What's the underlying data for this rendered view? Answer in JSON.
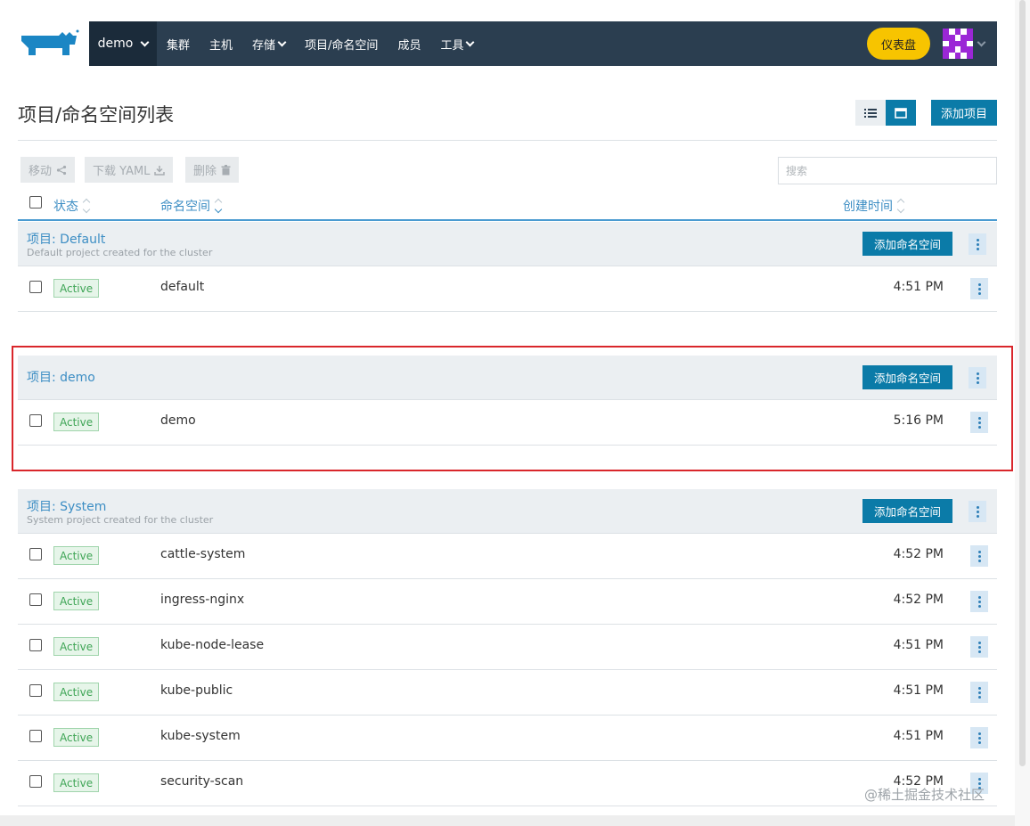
{
  "topbar": {
    "cluster": "demo",
    "nav": [
      "集群",
      "主机",
      "存储",
      "项目/命名空间",
      "成员",
      "工具"
    ],
    "dashboard_label": "仪表盘"
  },
  "header": {
    "title": "项目/命名空间列表",
    "add_project": "添加项目"
  },
  "toolbar": {
    "move": "移动",
    "download_yaml": "下载 YAML",
    "delete": "删除",
    "search_placeholder": "搜索"
  },
  "columns": {
    "state": "状态",
    "namespace": "命名空间",
    "created": "创建时间"
  },
  "add_namespace_label": "添加命名空间",
  "groups": [
    {
      "title": "项目: Default",
      "subtitle": "Default project created for the cluster",
      "rows": [
        {
          "state": "Active",
          "name": "default",
          "time": "4:51 PM"
        }
      ]
    },
    {
      "title": "项目: demo",
      "subtitle": "",
      "rows": [
        {
          "state": "Active",
          "name": "demo",
          "time": "5:16 PM"
        }
      ]
    },
    {
      "title": "项目: System",
      "subtitle": "System project created for the cluster",
      "rows": [
        {
          "state": "Active",
          "name": "cattle-system",
          "time": "4:52 PM"
        },
        {
          "state": "Active",
          "name": "ingress-nginx",
          "time": "4:52 PM"
        },
        {
          "state": "Active",
          "name": "kube-node-lease",
          "time": "4:51 PM"
        },
        {
          "state": "Active",
          "name": "kube-public",
          "time": "4:51 PM"
        },
        {
          "state": "Active",
          "name": "kube-system",
          "time": "4:51 PM"
        },
        {
          "state": "Active",
          "name": "security-scan",
          "time": "4:52 PM"
        }
      ]
    }
  ],
  "watermark": "@稀土掘金技术社区",
  "colors": {
    "nav_bg": "#2b3e50",
    "primary": "#0b7ba8",
    "dashboard": "#f7c400",
    "active_badge": "#3fa556",
    "highlight": "#d9262b"
  }
}
